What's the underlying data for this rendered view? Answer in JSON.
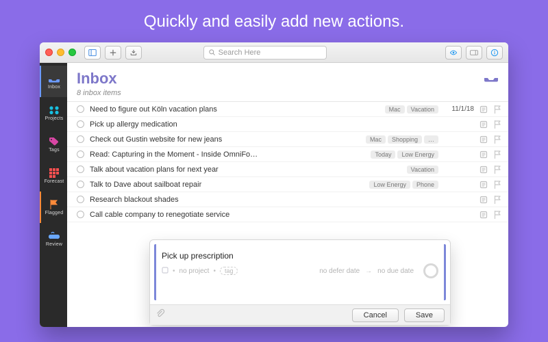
{
  "hero": "Quickly and easily add new actions.",
  "toolbar": {
    "search_placeholder": "Search Here"
  },
  "sidebar": {
    "items": [
      {
        "id": "inbox",
        "label": "Inbox"
      },
      {
        "id": "projects",
        "label": "Projects"
      },
      {
        "id": "tags",
        "label": "Tags"
      },
      {
        "id": "forecast",
        "label": "Forecast"
      },
      {
        "id": "flagged",
        "label": "Flagged"
      },
      {
        "id": "review",
        "label": "Review"
      }
    ]
  },
  "main": {
    "title": "Inbox",
    "subtitle": "8 inbox items"
  },
  "items": [
    {
      "title": "Need to figure out Köln vacation plans",
      "tags": [
        "Mac",
        "Vacation"
      ],
      "date": "11/1/18"
    },
    {
      "title": "Pick up allergy medication",
      "tags": [],
      "date": ""
    },
    {
      "title": "Check out Gustin website for new jeans",
      "tags": [
        "Mac",
        "Shopping",
        "…"
      ],
      "date": ""
    },
    {
      "title": "Read: Capturing in the Moment - Inside OmniFo…",
      "tags": [
        "Today",
        "Low Energy"
      ],
      "date": ""
    },
    {
      "title": "Talk about vacation plans for next year",
      "tags": [
        "Vacation"
      ],
      "date": ""
    },
    {
      "title": "Talk to Dave about sailboat repair",
      "tags": [
        "Low Energy",
        "Phone"
      ],
      "date": ""
    },
    {
      "title": "Research blackout shades",
      "tags": [],
      "date": ""
    },
    {
      "title": "Call cable company to renegotiate service",
      "tags": [],
      "date": ""
    }
  ],
  "quick": {
    "title": "Pick up prescription",
    "no_project": "no project",
    "tag_placeholder": "tag",
    "no_defer": "no defer date",
    "no_due": "no due date",
    "cancel": "Cancel",
    "save": "Save"
  }
}
